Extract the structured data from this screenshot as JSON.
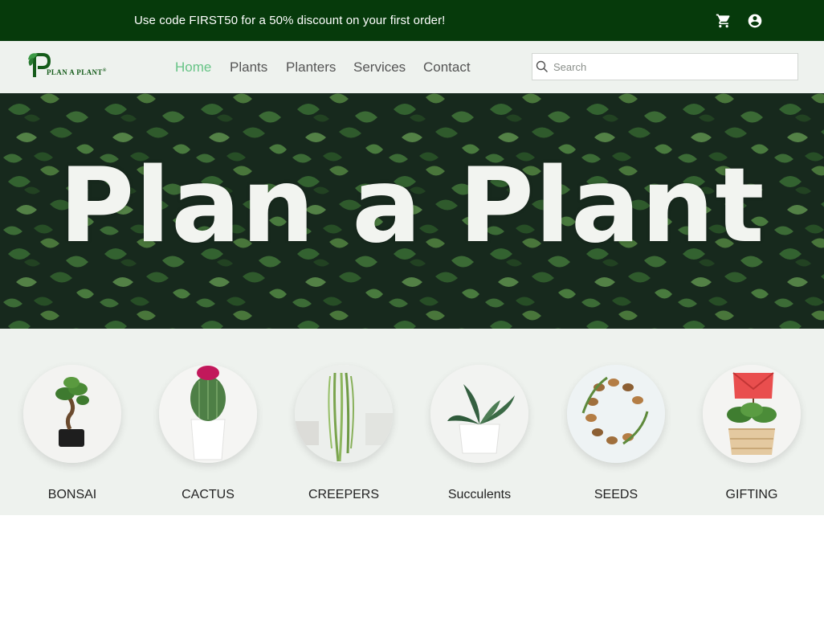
{
  "promo": {
    "message": "Use code FIRST50 for a 50% discount on your first order!",
    "cart_icon": "shopping-cart-icon",
    "account_icon": "account-circle-icon"
  },
  "nav": {
    "logo_text": "PLAN A PLANT",
    "logo_mark": "®",
    "links": [
      {
        "label": "Home",
        "active": true
      },
      {
        "label": "Plants",
        "active": false
      },
      {
        "label": "Planters",
        "active": false
      },
      {
        "label": "Services",
        "active": false
      },
      {
        "label": "Contact",
        "active": false
      }
    ],
    "search": {
      "placeholder": "Search",
      "value": "",
      "icon": "search-icon"
    },
    "active_color": "#67c486"
  },
  "hero": {
    "title": "Plan a Plant"
  },
  "categories": [
    {
      "label": "BONSAI"
    },
    {
      "label": "CACTUS"
    },
    {
      "label": "CREEPERS"
    },
    {
      "label": "Succulents"
    },
    {
      "label": "SEEDS"
    },
    {
      "label": "GIFTING"
    }
  ],
  "colors": {
    "promo_bg": "#063a0b",
    "nav_bg": "#eef2ee",
    "brand_green": "#155c1a"
  }
}
